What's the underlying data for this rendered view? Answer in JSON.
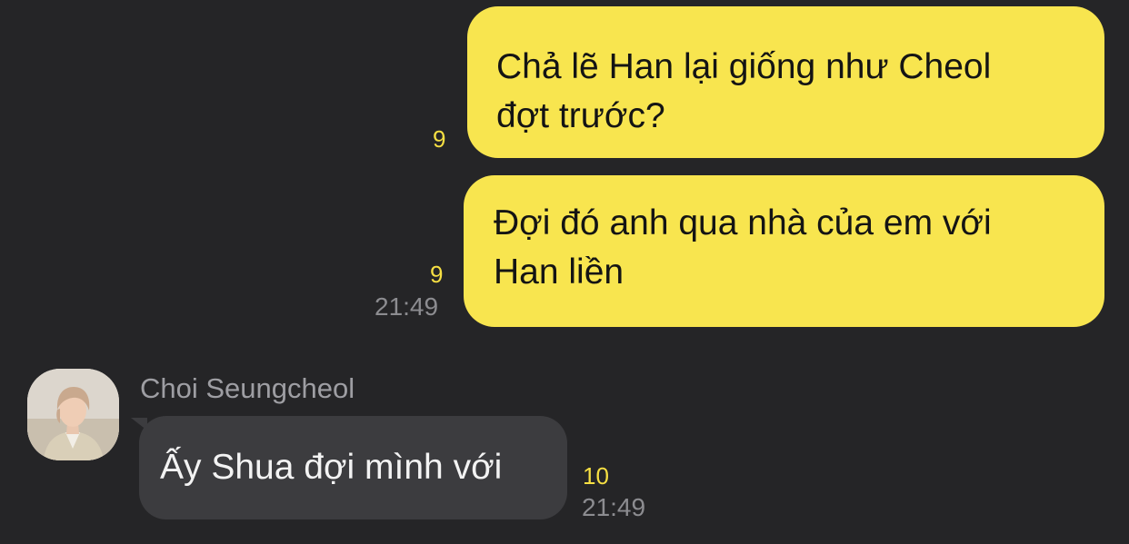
{
  "messages_outgoing": [
    {
      "text": "Chả lẽ Han lại giống như Cheol\nđợt trước?",
      "unread_count": "9",
      "time": ""
    },
    {
      "text": "Đợi đó anh qua nhà của em với\nHan liền",
      "unread_count": "9",
      "time": "21:49"
    }
  ],
  "message_incoming": {
    "sender": "Choi Seungcheol",
    "text": "Ấy Shua đợi mình với",
    "unread_count": "10",
    "time": "21:49"
  },
  "colors": {
    "background": "#252527",
    "outgoing_bubble": "#f8e54f",
    "incoming_bubble": "#3c3c3f",
    "unread_count": "#f6df43",
    "timestamp": "#8c8c90"
  },
  "icons": {
    "avatar": "profile-photo"
  }
}
